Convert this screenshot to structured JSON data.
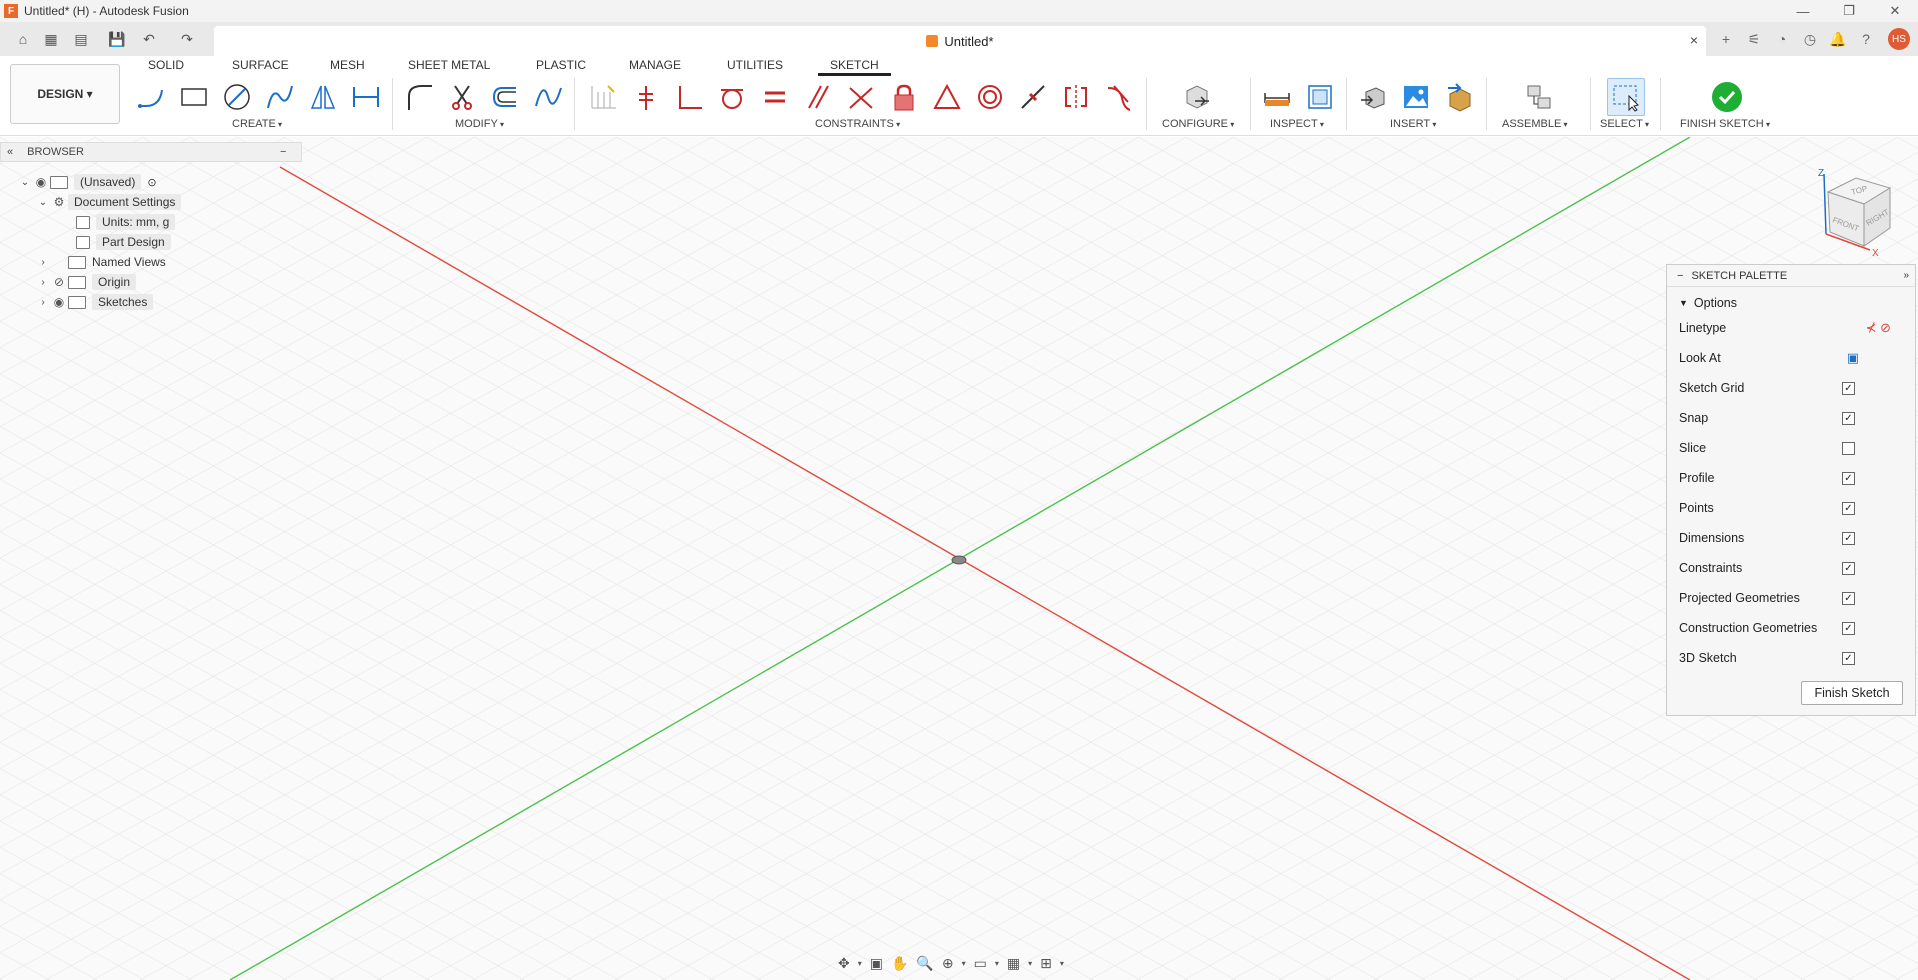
{
  "window": {
    "title": "Untitled* (H) - Autodesk Fusion",
    "logo_letter": "F"
  },
  "doc_tab": {
    "title": "Untitled*",
    "close": "×"
  },
  "user": {
    "initials": "HS"
  },
  "workspace": {
    "label": "DESIGN ▾"
  },
  "ribbon_tabs": [
    "SOLID",
    "SURFACE",
    "MESH",
    "SHEET METAL",
    "PLASTIC",
    "MANAGE",
    "UTILITIES",
    "SKETCH"
  ],
  "ribbon_groups": {
    "create": "CREATE",
    "modify": "MODIFY",
    "constraints": "CONSTRAINTS",
    "configure": "CONFIGURE",
    "inspect": "INSPECT",
    "insert": "INSERT",
    "assemble": "ASSEMBLE",
    "select": "SELECT",
    "finish": "FINISH SKETCH"
  },
  "browser": {
    "title": "BROWSER",
    "root": "(Unsaved)",
    "doc_settings": "Document Settings",
    "units": "Units: mm, g",
    "part_design": "Part Design",
    "named_views": "Named Views",
    "origin": "Origin",
    "sketches": "Sketches"
  },
  "palette": {
    "title": "SKETCH PALETTE",
    "section": "Options",
    "rows": [
      {
        "label": "Linetype",
        "type": "icon"
      },
      {
        "label": "Look At",
        "type": "icon"
      },
      {
        "label": "Sketch Grid",
        "checked": true
      },
      {
        "label": "Snap",
        "checked": true
      },
      {
        "label": "Slice",
        "checked": false
      },
      {
        "label": "Profile",
        "checked": true
      },
      {
        "label": "Points",
        "checked": true
      },
      {
        "label": "Dimensions",
        "checked": true
      },
      {
        "label": "Constraints",
        "checked": true
      },
      {
        "label": "Projected Geometries",
        "checked": true
      },
      {
        "label": "Construction Geometries",
        "checked": true
      },
      {
        "label": "3D Sketch",
        "checked": true
      }
    ],
    "finish_button": "Finish Sketch"
  },
  "viewcube": {
    "top": "TOP",
    "front": "FRONT",
    "right": "RIGHT",
    "z": "Z",
    "x": "X"
  },
  "colors": {
    "x_axis": "#e0493a",
    "y_axis": "#4cc24c",
    "accent": "#0696d7",
    "finish": "#1fae34"
  }
}
